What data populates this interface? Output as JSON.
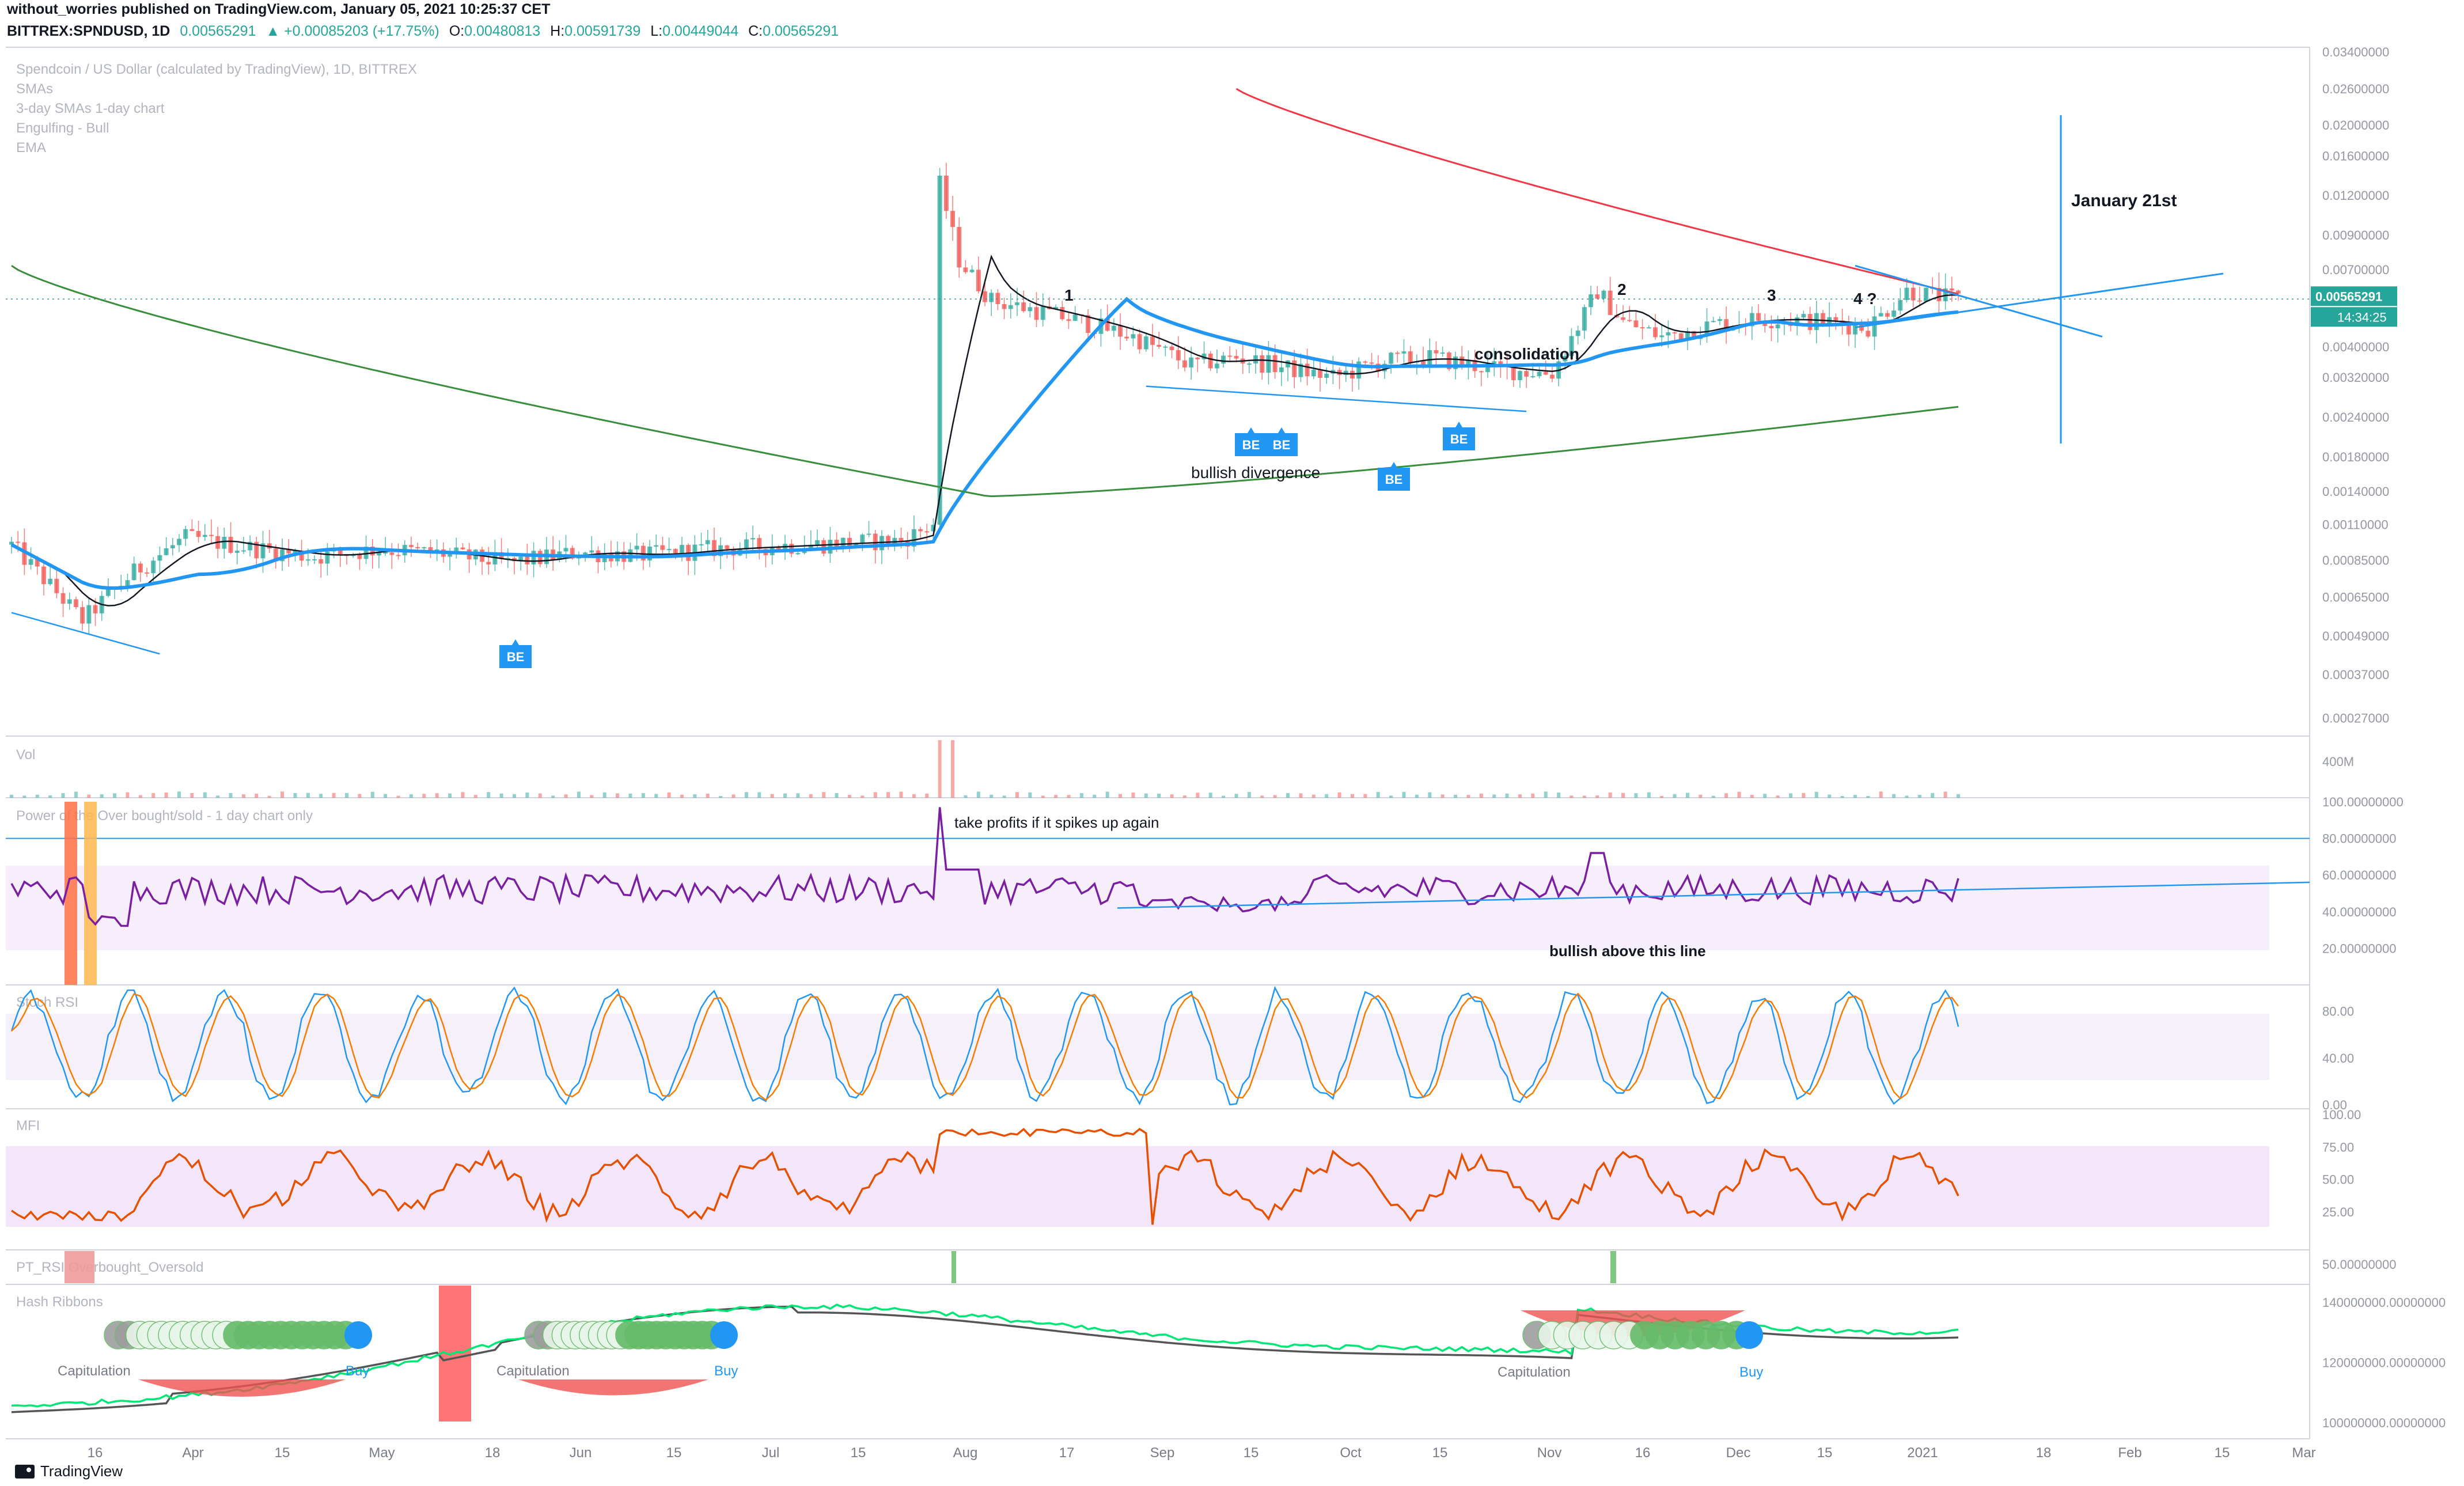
{
  "header": {
    "published_by": "without_worries published on TradingView.com, January 05, 2021 10:25:37 CET",
    "symbol_line": "BITTREX:SPNDUSD, 1D",
    "close_value": "0.00565291",
    "change_value": "+0.00085203 (+17.75%)",
    "o_label": "O:",
    "o_value": "0.00480813",
    "h_label": "H:",
    "h_value": "0.00591739",
    "l_label": "L:",
    "l_value": "0.00449044",
    "c_label": "C:",
    "c_value": "0.00565291"
  },
  "brand": "TradingView",
  "chart_data": {
    "type": "line",
    "title": "Spendcoin / US Dollar (calculated by TradingView), 1D, BITTREX",
    "legend_items": [
      "SMAs",
      "3-day SMAs 1-day chart",
      "Engulfing - Bull",
      "EMA"
    ],
    "x_axis_labels": [
      "16",
      "Apr",
      "15",
      "May",
      "18",
      "Jun",
      "15",
      "Jul",
      "15",
      "Aug",
      "17",
      "Sep",
      "15",
      "Oct",
      "15",
      "Nov",
      "16",
      "Dec",
      "15",
      "2021",
      "18",
      "Feb",
      "15",
      "Mar"
    ],
    "y_scale": "log",
    "price_axis_labels": [
      "0.03400000",
      "0.02600000",
      "0.02000000",
      "0.01600000",
      "0.01200000",
      "0.00900000",
      "0.00700000",
      "0.00400000",
      "0.00320000",
      "0.00240000",
      "0.00180000",
      "0.00140000",
      "0.00110000",
      "0.00085000",
      "0.00065000",
      "0.00049000",
      "0.00037000",
      "0.00027000"
    ],
    "last_price_label": "0.00565291",
    "countdown_label": "14:34:25",
    "price_series": {
      "name": "SPNDUSD close",
      "x": [
        "2020-03-09",
        "2020-03-20",
        "2020-03-28",
        "2020-04-05",
        "2020-04-15",
        "2020-04-25",
        "2020-05-05",
        "2020-05-15",
        "2020-05-25",
        "2020-06-05",
        "2020-06-15",
        "2020-06-25",
        "2020-07-05",
        "2020-07-15",
        "2020-07-25",
        "2020-07-30",
        "2020-07-31",
        "2020-08-03",
        "2020-08-08",
        "2020-08-15",
        "2020-08-22",
        "2020-08-30",
        "2020-09-08",
        "2020-09-15",
        "2020-09-22",
        "2020-09-30",
        "2020-10-08",
        "2020-10-15",
        "2020-10-25",
        "2020-11-03",
        "2020-11-10",
        "2020-11-14",
        "2020-11-20",
        "2020-11-28",
        "2020-12-05",
        "2020-12-15",
        "2020-12-22",
        "2020-12-28",
        "2021-01-01",
        "2021-01-05"
      ],
      "y": [
        0.00095,
        0.00055,
        0.00078,
        0.001,
        0.00093,
        0.00087,
        0.00092,
        0.00089,
        0.00083,
        0.0009,
        0.00088,
        0.00092,
        0.00094,
        0.00096,
        0.00098,
        0.0011,
        0.013,
        0.0075,
        0.0056,
        0.0052,
        0.0048,
        0.0043,
        0.0035,
        0.0037,
        0.00345,
        0.0032,
        0.0036,
        0.0037,
        0.0034,
        0.0033,
        0.006,
        0.0048,
        0.0043,
        0.0047,
        0.0049,
        0.0048,
        0.0046,
        0.006,
        0.0058,
        0.00565
      ]
    },
    "annotations": [
      "1",
      "2",
      "3",
      "4 ?",
      "consolidation",
      "bullish divergence",
      "January 21st",
      "BE"
    ],
    "panes": [
      {
        "name": "Vol",
        "axis_label": "400M"
      },
      {
        "name": "Power of the Over bought/sold - 1 day chart only",
        "axis_labels": [
          "100.00000000",
          "80.00000000",
          "60.00000000",
          "40.00000000",
          "20.00000000"
        ],
        "notes": [
          "take profits if it spikes up again",
          "bullish above this line"
        ]
      },
      {
        "name": "Stoch RSI",
        "axis_labels": [
          "80.00",
          "40.00",
          "0.00"
        ]
      },
      {
        "name": "MFI",
        "axis_labels": [
          "100.00",
          "75.00",
          "50.00",
          "25.00"
        ]
      },
      {
        "name": "PT_RSI Overbought_Oversold",
        "axis_labels": [
          "50.00000000"
        ]
      },
      {
        "name": "Hash Ribbons",
        "axis_labels": [
          "140000000.00000000",
          "120000000.00000000",
          "100000000.00000000"
        ],
        "labels": [
          "Capitulation",
          "Buy"
        ]
      }
    ],
    "colors": {
      "up": "#26a69a",
      "down": "#ef5350",
      "sma_red": "#f23645",
      "sma_green": "#388e3c",
      "ema_blue": "#2196f3",
      "rsi_purple": "#7b1fa2",
      "stoch_blue": "#2196f3",
      "stoch_orange": "#f57c00",
      "mfi_orange": "#e65100",
      "hash_green": "#00e676",
      "hash_gray": "#555555",
      "buy_blue": "#2196f3"
    }
  }
}
